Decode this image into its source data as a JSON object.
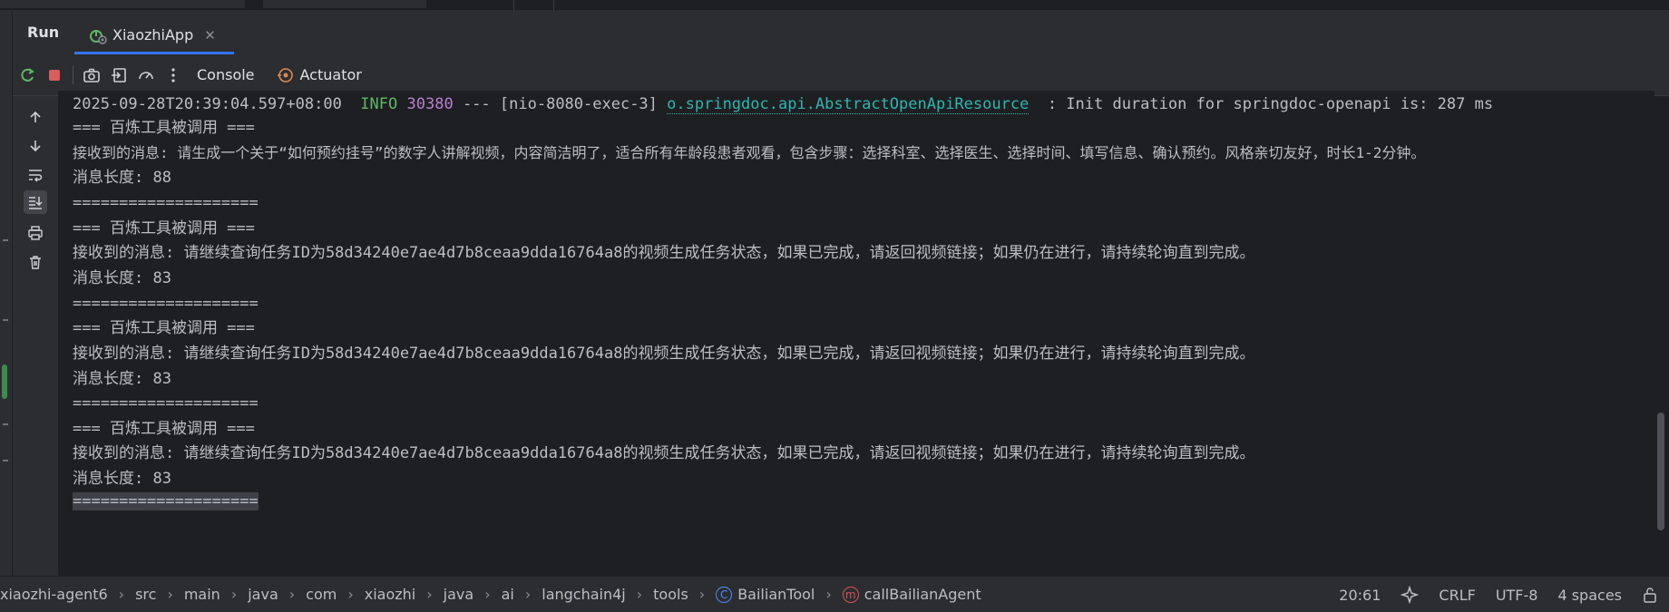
{
  "run_window": {
    "title": "Run",
    "tab": {
      "label": "XiaozhiApp",
      "icon": "spring-boot-app-icon"
    }
  },
  "toolbar": {
    "console_label": "Console",
    "actuator_label": "Actuator"
  },
  "console": {
    "log_line": {
      "timestamp": "2025-09-28T20:39:04.597+08:00",
      "level": "INFO",
      "pid": "30380",
      "sep": "---",
      "thread": "[nio-8080-exec-3]",
      "logger": "o.springdoc.api.AbstractOpenApiResource",
      "message": ": Init duration for springdoc-openapi is: 287 ms"
    },
    "lines": [
      "=== 百炼工具被调用 ===",
      "接收到的消息: 请生成一个关于“如何预约挂号”的数字人讲解视频，内容简洁明了，适合所有年龄段患者观看，包含步骤：选择科室、选择医生、选择时间、填写信息、确认预约。风格亲切友好，时长1-2分钟。",
      "消息长度: 88",
      "====================",
      "=== 百炼工具被调用 ===",
      "接收到的消息: 请继续查询任务ID为58d34240e7ae4d7b8ceaa9dda16764a8的视频生成任务状态，如果已完成，请返回视频链接；如果仍在进行，请持续轮询直到完成。",
      "消息长度: 83",
      "====================",
      "=== 百炼工具被调用 ===",
      "接收到的消息: 请继续查询任务ID为58d34240e7ae4d7b8ceaa9dda16764a8的视频生成任务状态，如果已完成，请返回视频链接；如果仍在进行，请持续轮询直到完成。",
      "消息长度: 83",
      "====================",
      "=== 百炼工具被调用 ===",
      "接收到的消息: 请继续查询任务ID为58d34240e7ae4d7b8ceaa9dda16764a8的视频生成任务状态，如果已完成，请返回视频链接；如果仍在进行，请持续轮询直到完成。",
      "消息长度: 83",
      "===================="
    ]
  },
  "statusbar": {
    "breadcrumb": [
      "xiaozhi-agent6",
      "src",
      "main",
      "java",
      "com",
      "xiaozhi",
      "java",
      "ai",
      "langchain4j",
      "tools"
    ],
    "class_name": "BailianTool",
    "method_name": "callBailianAgent",
    "position": "20:61",
    "line_sep": "CRLF",
    "encoding": "UTF-8",
    "indent": "4 spaces"
  },
  "colors": {
    "accent": "#3574f0",
    "info": "#5fb865",
    "pid": "#b87fd1",
    "logger": "#2fb5b0"
  }
}
